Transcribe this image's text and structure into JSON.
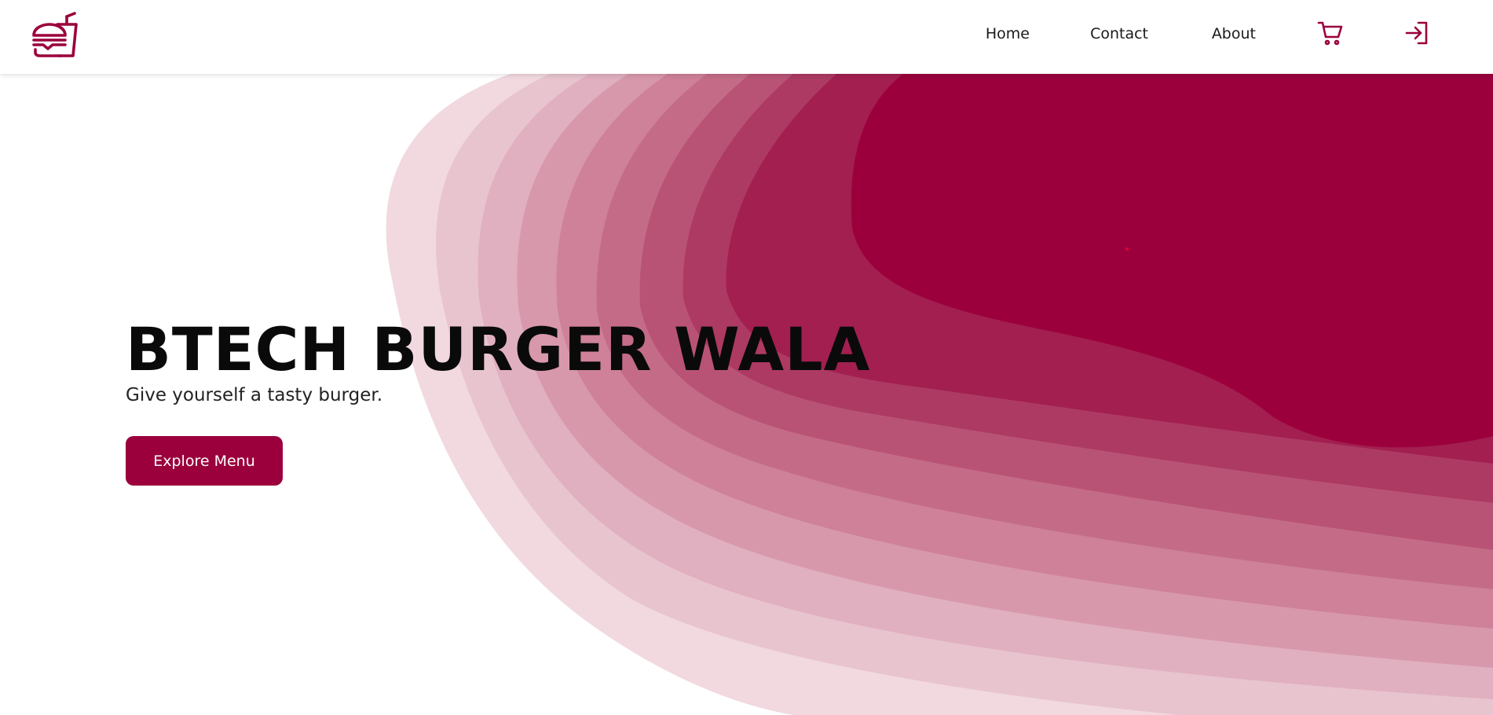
{
  "brand": {
    "logo_icon": "burger-and-drink-icon",
    "accent_color": "#9b003c"
  },
  "nav": {
    "links": [
      {
        "label": "Home"
      },
      {
        "label": "Contact"
      },
      {
        "label": "About"
      }
    ],
    "cart_icon": "cart-icon",
    "login_icon": "login-icon"
  },
  "hero": {
    "title": "BTECH BURGER WALA",
    "subtitle": "Give yourself a tasty burger.",
    "cta_label": "Explore Menu"
  }
}
